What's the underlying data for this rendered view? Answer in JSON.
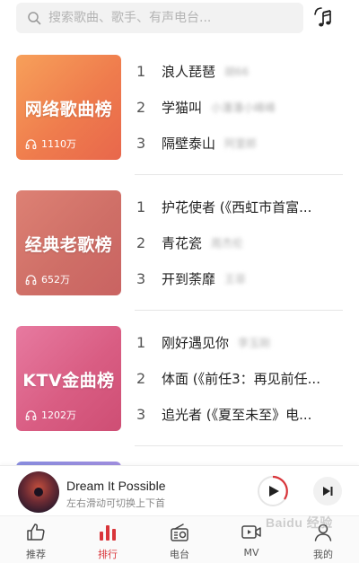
{
  "search": {
    "placeholder": "搜索歌曲、歌手、有声电台..."
  },
  "charts": [
    {
      "title": "网络歌曲榜",
      "play_count": "1110万",
      "songs": [
        {
          "rank": "1",
          "name": "浪人琵琶",
          "artist": "胡66"
        },
        {
          "rank": "2",
          "name": "学猫叫",
          "artist": "小潘潘小峰峰"
        },
        {
          "rank": "3",
          "name": "隔壁泰山",
          "artist": "阿里郎"
        }
      ]
    },
    {
      "title": "经典老歌榜",
      "play_count": "652万",
      "songs": [
        {
          "rank": "1",
          "name": "护花使者 (《西虹市首富...",
          "artist": ""
        },
        {
          "rank": "2",
          "name": "青花瓷",
          "artist": "周杰伦"
        },
        {
          "rank": "3",
          "name": "开到荼靡",
          "artist": "王菲"
        }
      ]
    },
    {
      "title": "KTV金曲榜",
      "play_count": "1202万",
      "songs": [
        {
          "rank": "1",
          "name": "刚好遇见你",
          "artist": "李玉刚"
        },
        {
          "rank": "2",
          "name": "体面 (《前任3：再见前任...",
          "artist": ""
        },
        {
          "rank": "3",
          "name": "追光者 (《夏至未至》电...",
          "artist": ""
        }
      ]
    }
  ],
  "player": {
    "title": "Dream It Possible",
    "subtitle": "左右滑动可切换上下首"
  },
  "tabs": [
    {
      "label": "推荐",
      "icon": "thumbs-up-icon"
    },
    {
      "label": "排行",
      "icon": "ranking-icon"
    },
    {
      "label": "电台",
      "icon": "radio-icon"
    },
    {
      "label": "MV",
      "icon": "mv-icon"
    },
    {
      "label": "我的",
      "icon": "profile-icon"
    }
  ],
  "watermark": "Baidu 经验",
  "colors": {
    "accent": "#d9353a",
    "orange_cover": "#ef7c4d",
    "rose_cover": "#cf6f67",
    "pink_cover": "#d95d83"
  }
}
